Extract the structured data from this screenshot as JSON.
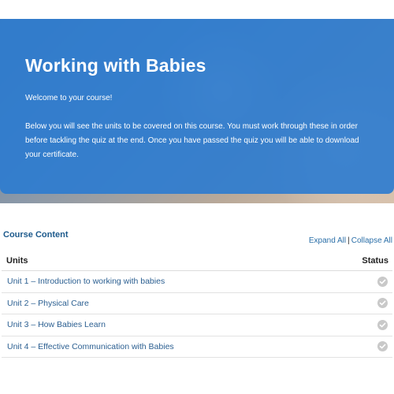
{
  "hero": {
    "title": "Working with Babies",
    "welcome": "Welcome to your course!",
    "description": "Below you will see the units to be covered on this course. You must work through these in order before tackling the quiz at the end. Once you have passed the quiz you will be able to download your certificate.",
    "overlay_color": "#2b7bd0"
  },
  "course_content": {
    "title": "Course Content",
    "expand_all": "Expand All",
    "separator": "|",
    "collapse_all": "Collapse All"
  },
  "table": {
    "col_units": "Units",
    "col_status": "Status",
    "rows": [
      {
        "label": "Unit 1 – Introduction to working with babies",
        "status_icon": "check-circle-icon"
      },
      {
        "label": "Unit 2 – Physical Care",
        "status_icon": "check-circle-icon"
      },
      {
        "label": "Unit 3 – How Babies Learn",
        "status_icon": "check-circle-icon"
      },
      {
        "label": "Unit 4 – Effective Communication with Babies",
        "status_icon": "check-circle-icon"
      }
    ]
  }
}
